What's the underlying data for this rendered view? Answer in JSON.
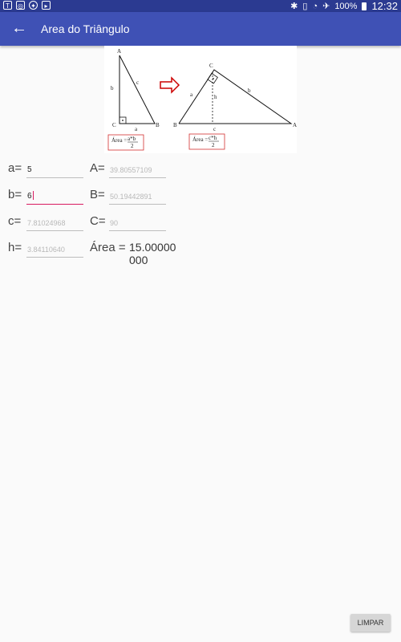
{
  "status_bar": {
    "left_icons": [
      "nyt-icon",
      "instagram-icon",
      "compass-icon",
      "tv-icon"
    ],
    "battery": "100%",
    "time": "12:32"
  },
  "toolbar": {
    "title": "Area do Triângulo"
  },
  "diagram": {
    "left": {
      "labels": {
        "A": "A",
        "B": "B",
        "C": "C",
        "a": "a",
        "b": "b",
        "c": "c"
      },
      "formula_prefix": "Área =",
      "formula_num": "a*b",
      "formula_den": "2"
    },
    "right": {
      "labels": {
        "A": "A",
        "B": "B",
        "C": "C",
        "a": "a",
        "b": "b",
        "c": "c",
        "h": "h"
      },
      "formula_prefix": "Área =",
      "formula_num": "c*h",
      "formula_den": "2"
    },
    "arrow_color": "#cc0000",
    "formula_box_color": "#d32f2f"
  },
  "form": {
    "a": {
      "label": "a=",
      "value": "5"
    },
    "b": {
      "label": "b=",
      "value": "6"
    },
    "c": {
      "label": "c=",
      "value": "7.81024968"
    },
    "h": {
      "label": "h=",
      "value": "3.84110640"
    },
    "A": {
      "label": "A=",
      "value": "39.80557109"
    },
    "B": {
      "label": "B=",
      "value": "50.19442891"
    },
    "C": {
      "label": "C=",
      "value": "90"
    },
    "area": {
      "label": "Área =",
      "value": "15.00000000"
    }
  },
  "buttons": {
    "clear": "LIMPAR"
  },
  "colors": {
    "status_bar": "#2b3a91",
    "toolbar": "#3f51b5",
    "accent": "#d81b60"
  }
}
